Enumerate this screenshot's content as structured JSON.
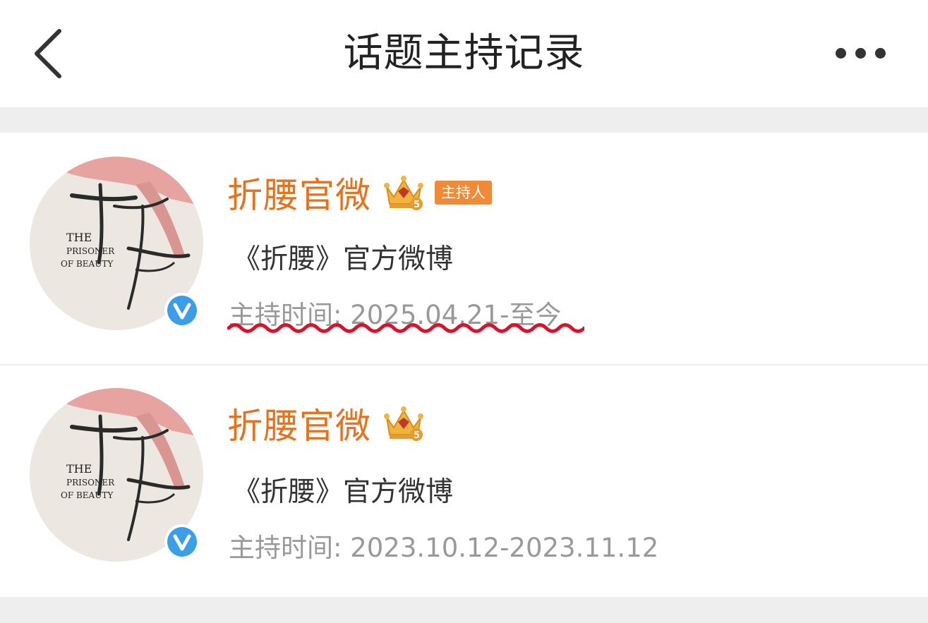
{
  "header": {
    "title": "话题主持记录",
    "back_icon": "chevron-left-icon",
    "more_icon": "more-dots-icon"
  },
  "records": [
    {
      "name": "折腰官微",
      "level_badge": "5",
      "host_badge": "主持人",
      "description": "《折腰》官方微博",
      "host_time": "主持时间: 2025.04.21-至今",
      "avatar_text": {
        "title_cn": "折腰",
        "line1": "THE",
        "line2": "PRISONER",
        "line3": "OF BEAUTY"
      },
      "annotation": "red-wavy-underline"
    },
    {
      "name": "折腰官微",
      "level_badge": "5",
      "description": "《折腰》官方微博",
      "host_time": "主持时间: 2023.10.12-2023.11.12",
      "avatar_text": {
        "title_cn": "折腰",
        "line1": "THE",
        "line2": "PRISONER",
        "line3": "OF BEAUTY"
      }
    }
  ],
  "colors": {
    "name": "#e8711c",
    "host_badge_bg": "#f08a36",
    "verified": "#3b9ee8",
    "annotation": "#d9142a",
    "time_text": "#999999"
  }
}
